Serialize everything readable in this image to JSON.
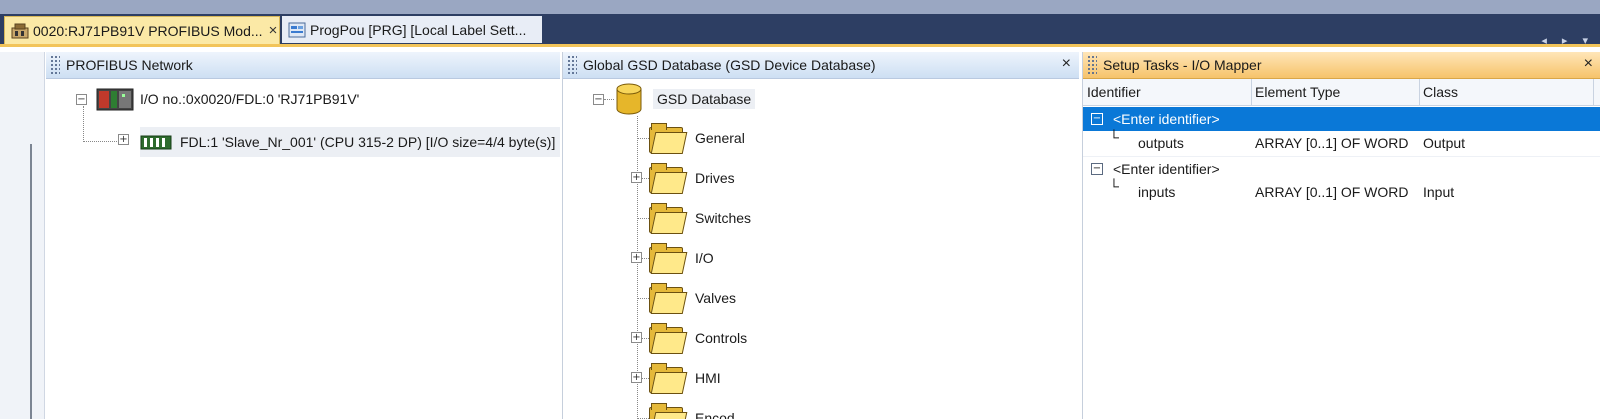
{
  "tabs": [
    {
      "label": "0020:RJ71PB91V PROFIBUS Mod...",
      "close": "×"
    },
    {
      "label": "ProgPou [PRG] [Local Label Sett..."
    }
  ],
  "tab_scroll": "◂ ▸ ▾",
  "profibus_panel": {
    "title": "PROFIBUS Network",
    "root_node": "I/O no.:0x0020/FDL:0 'RJ71PB91V'",
    "child_node": "FDL:1 'Slave_Nr_001' (CPU 315-2 DP) [I/O size=4/4 byte(s)]"
  },
  "gsd_panel": {
    "title": "Global GSD Database (GSD Device Database)",
    "close": "×",
    "root": "GSD Database",
    "folders": [
      {
        "label": "General",
        "expandable": false
      },
      {
        "label": "Drives",
        "expandable": true
      },
      {
        "label": "Switches",
        "expandable": false
      },
      {
        "label": "I/O",
        "expandable": true
      },
      {
        "label": "Valves",
        "expandable": false
      },
      {
        "label": "Controls",
        "expandable": true
      },
      {
        "label": "HMI",
        "expandable": true
      },
      {
        "label": "Encod",
        "expandable": false
      }
    ],
    "expand_plus": "+",
    "collapse_minus": "−"
  },
  "mapper_panel": {
    "title": "Setup Tasks - I/O Mapper",
    "close": "×",
    "columns": [
      "Identifier",
      "Element Type",
      "Class"
    ],
    "groups": [
      {
        "header": "<Enter identifier>",
        "selected": true,
        "child": {
          "identifier": "outputs",
          "type": "ARRAY [0..1] OF WORD",
          "class": "Output"
        }
      },
      {
        "header": "<Enter identifier>",
        "selected": false,
        "child": {
          "identifier": "inputs",
          "type": "ARRAY [0..1] OF WORD",
          "class": "Input"
        }
      }
    ]
  },
  "colors": {
    "tabbar": "#2d3e63",
    "active_tab": "#fbe9a6",
    "selection": "#0a78d7",
    "mapper_header": "#f6c36b"
  }
}
